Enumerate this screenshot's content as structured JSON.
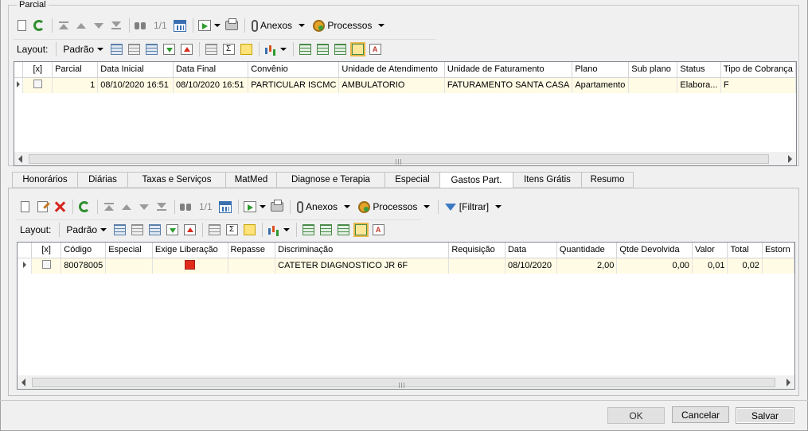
{
  "top_group": {
    "title": "Parcial"
  },
  "toolbar1": {
    "counter": "1/1",
    "anexos_label": "Anexos",
    "processos_label": "Processos",
    "layout_label": "Layout:",
    "padrao_label": "Padrão"
  },
  "grid1": {
    "columns": [
      "[x]",
      "Parcial",
      "Data Inicial",
      "Data Final",
      "Convênio",
      "Unidade de Atendimento",
      "Unidade de Faturamento",
      "Plano",
      "Sub plano",
      "Status",
      "Tipo de Cobrança"
    ],
    "rows": [
      {
        "parcial": "1",
        "data_inicial": "08/10/2020 16:51",
        "data_final": "08/10/2020 16:51",
        "convenio": "PARTICULAR ISCMC",
        "unidade_atendimento": "AMBULATORIO",
        "unidade_faturamento": "FATURAMENTO SANTA CASA",
        "plano": "Apartamento",
        "sub_plano": "",
        "status": "Elabora...",
        "tipo_cobranca": "F"
      }
    ]
  },
  "tabs": [
    {
      "label": "Honorários",
      "active": false
    },
    {
      "label": "Diárias",
      "active": false
    },
    {
      "label": "Taxas e Serviços",
      "active": false
    },
    {
      "label": "MatMed",
      "active": false
    },
    {
      "label": "Diagnose e Terapia",
      "active": false
    },
    {
      "label": "Especial",
      "active": false
    },
    {
      "label": "Gastos Part.",
      "active": true
    },
    {
      "label": "Itens Grátis",
      "active": false
    },
    {
      "label": "Resumo",
      "active": false
    }
  ],
  "toolbar2": {
    "counter": "1/1",
    "anexos_label": "Anexos",
    "processos_label": "Processos",
    "filtrar_label": "[Filtrar]",
    "layout_label": "Layout:",
    "padrao_label": "Padrão"
  },
  "grid2": {
    "columns": [
      "[x]",
      "Código",
      "Especial",
      "Exige Liberação",
      "Repasse",
      "Discriminação",
      "Requisição",
      "Data",
      "Quantidade",
      "Qtde Devolvida",
      "Valor",
      "Total",
      "Estorn"
    ],
    "rows": [
      {
        "codigo": "80078005",
        "especial": "",
        "exige_liberacao": "red-flag-icon",
        "repasse": "",
        "discriminacao": "CATETER DIAGNOSTICO JR 6F",
        "requisicao": "",
        "data": "08/10/2020",
        "quantidade": "2,00",
        "qtde_devolvida": "0,00",
        "valor": "0,01",
        "total": "0,02",
        "estorno": ""
      }
    ]
  },
  "buttons": {
    "ok": "OK",
    "cancelar": "Cancelar",
    "salvar": "Salvar"
  },
  "colors": {
    "row_highlight": "#fffbe5",
    "flag_red": "#e02b1c"
  }
}
